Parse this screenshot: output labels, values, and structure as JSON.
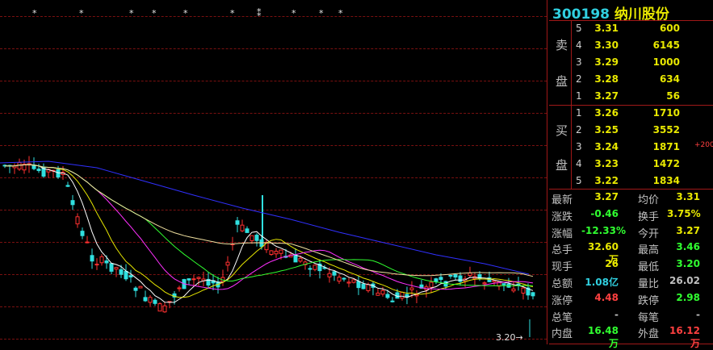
{
  "stock": {
    "code": "300198",
    "name": "纳川股份"
  },
  "markers": [
    "*",
    "*",
    "*",
    "*",
    "*",
    "*",
    "⁑",
    "*",
    "*",
    "*"
  ],
  "last_price_label": "3.20",
  "order_book": {
    "sell_label": [
      "卖",
      "盘"
    ],
    "buy_label": [
      "买",
      "盘"
    ],
    "sell": [
      {
        "level": "5",
        "price": "3.31",
        "volume": "600"
      },
      {
        "level": "4",
        "price": "3.30",
        "volume": "6145"
      },
      {
        "level": "3",
        "price": "3.29",
        "volume": "1000"
      },
      {
        "level": "2",
        "price": "3.28",
        "volume": "634"
      },
      {
        "level": "1",
        "price": "3.27",
        "volume": "56"
      }
    ],
    "buy": [
      {
        "level": "1",
        "price": "3.26",
        "volume": "1710"
      },
      {
        "level": "2",
        "price": "3.25",
        "volume": "3552"
      },
      {
        "level": "3",
        "price": "3.24",
        "volume": "1871"
      },
      {
        "level": "4",
        "price": "3.23",
        "volume": "1472"
      },
      {
        "level": "5",
        "price": "3.22",
        "volume": "1834"
      }
    ],
    "buy_change": "+200"
  },
  "stats": [
    {
      "l1": "最新",
      "v1": "3.27",
      "c1": "#e8e800",
      "l2": "均价",
      "v2": "3.31",
      "c2": "#e8e800"
    },
    {
      "l1": "涨跌",
      "v1": "-0.46",
      "c1": "#30ff30",
      "l2": "换手",
      "v2": "3.75%",
      "c2": "#e8e800"
    },
    {
      "l1": "涨幅",
      "v1": "-12.33%",
      "c1": "#30ff30",
      "l2": "今开",
      "v2": "3.27",
      "c2": "#e8e800"
    },
    {
      "l1": "总手",
      "v1": "32.60万",
      "c1": "#e8e800",
      "l2": "最高",
      "v2": "3.46",
      "c2": "#30ff30"
    },
    {
      "l1": "现手",
      "v1": "26",
      "c1": "#e8e800",
      "l2": "最低",
      "v2": "3.20",
      "c2": "#30ff30"
    },
    {
      "l1": "总额",
      "v1": "1.08亿",
      "c1": "#30d0e0",
      "l2": "量比",
      "v2": "26.02",
      "c2": "#c0c0c0"
    },
    {
      "l1": "涨停",
      "v1": "4.48",
      "c1": "#ff4040",
      "l2": "跌停",
      "v2": "2.98",
      "c2": "#30ff30"
    },
    {
      "l1": "总笔",
      "v1": "-",
      "c1": "#c0c0c0",
      "l2": "每笔",
      "v2": "-",
      "c2": "#c0c0c0"
    },
    {
      "l1": "内盘",
      "v1": "16.48万",
      "c1": "#30ff30",
      "l2": "外盘",
      "v2": "16.12万",
      "c2": "#ff4040"
    }
  ],
  "colors": {
    "up": "#ff3030",
    "down": "#30e0e0",
    "ma5": "#ffffff",
    "ma10": "#e8e800",
    "ma20": "#ff30ff",
    "ma30": "#30ff30",
    "ma60": "#f0e0a0",
    "ma120": "#3030ff"
  }
}
